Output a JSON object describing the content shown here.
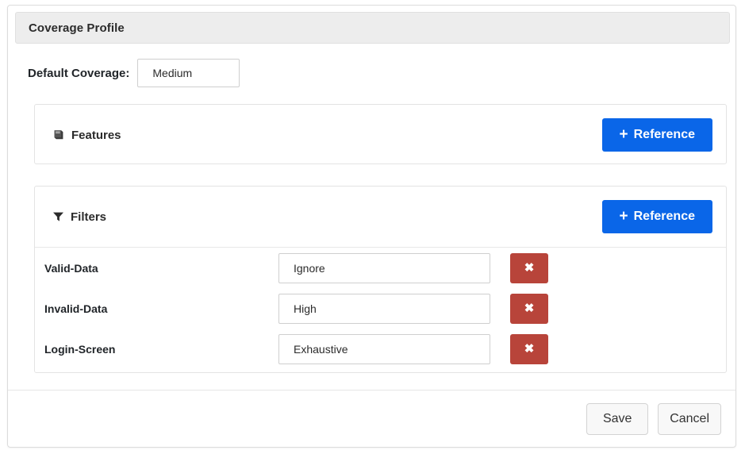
{
  "dialog": {
    "title": "Coverage Profile"
  },
  "default_coverage": {
    "label": "Default Coverage:",
    "value": "Medium",
    "placeholder": "Coverage"
  },
  "features_panel": {
    "title": "Features",
    "icon": "book-icon",
    "icon_glyph": "▤",
    "add_button": {
      "label": "Reference",
      "plus": "+",
      "color": "#0a66e8"
    }
  },
  "filters_panel": {
    "title": "Filters",
    "icon": "funnel-icon",
    "add_button": {
      "label": "Reference",
      "plus": "+",
      "color": "#0a66e8"
    },
    "rows": [
      {
        "name": "Valid-Data",
        "value": "Ignore",
        "placeholder": "Coverage",
        "delete_label": "✖"
      },
      {
        "name": "Invalid-Data",
        "value": "High",
        "placeholder": "Coverage",
        "delete_label": "✖"
      },
      {
        "name": "Login-Screen",
        "value": "Exhaustive",
        "placeholder": "Coverage",
        "delete_label": "✖"
      }
    ],
    "delete_color": "#b8443a"
  },
  "footer": {
    "save_label": "Save",
    "cancel_label": "Cancel"
  }
}
